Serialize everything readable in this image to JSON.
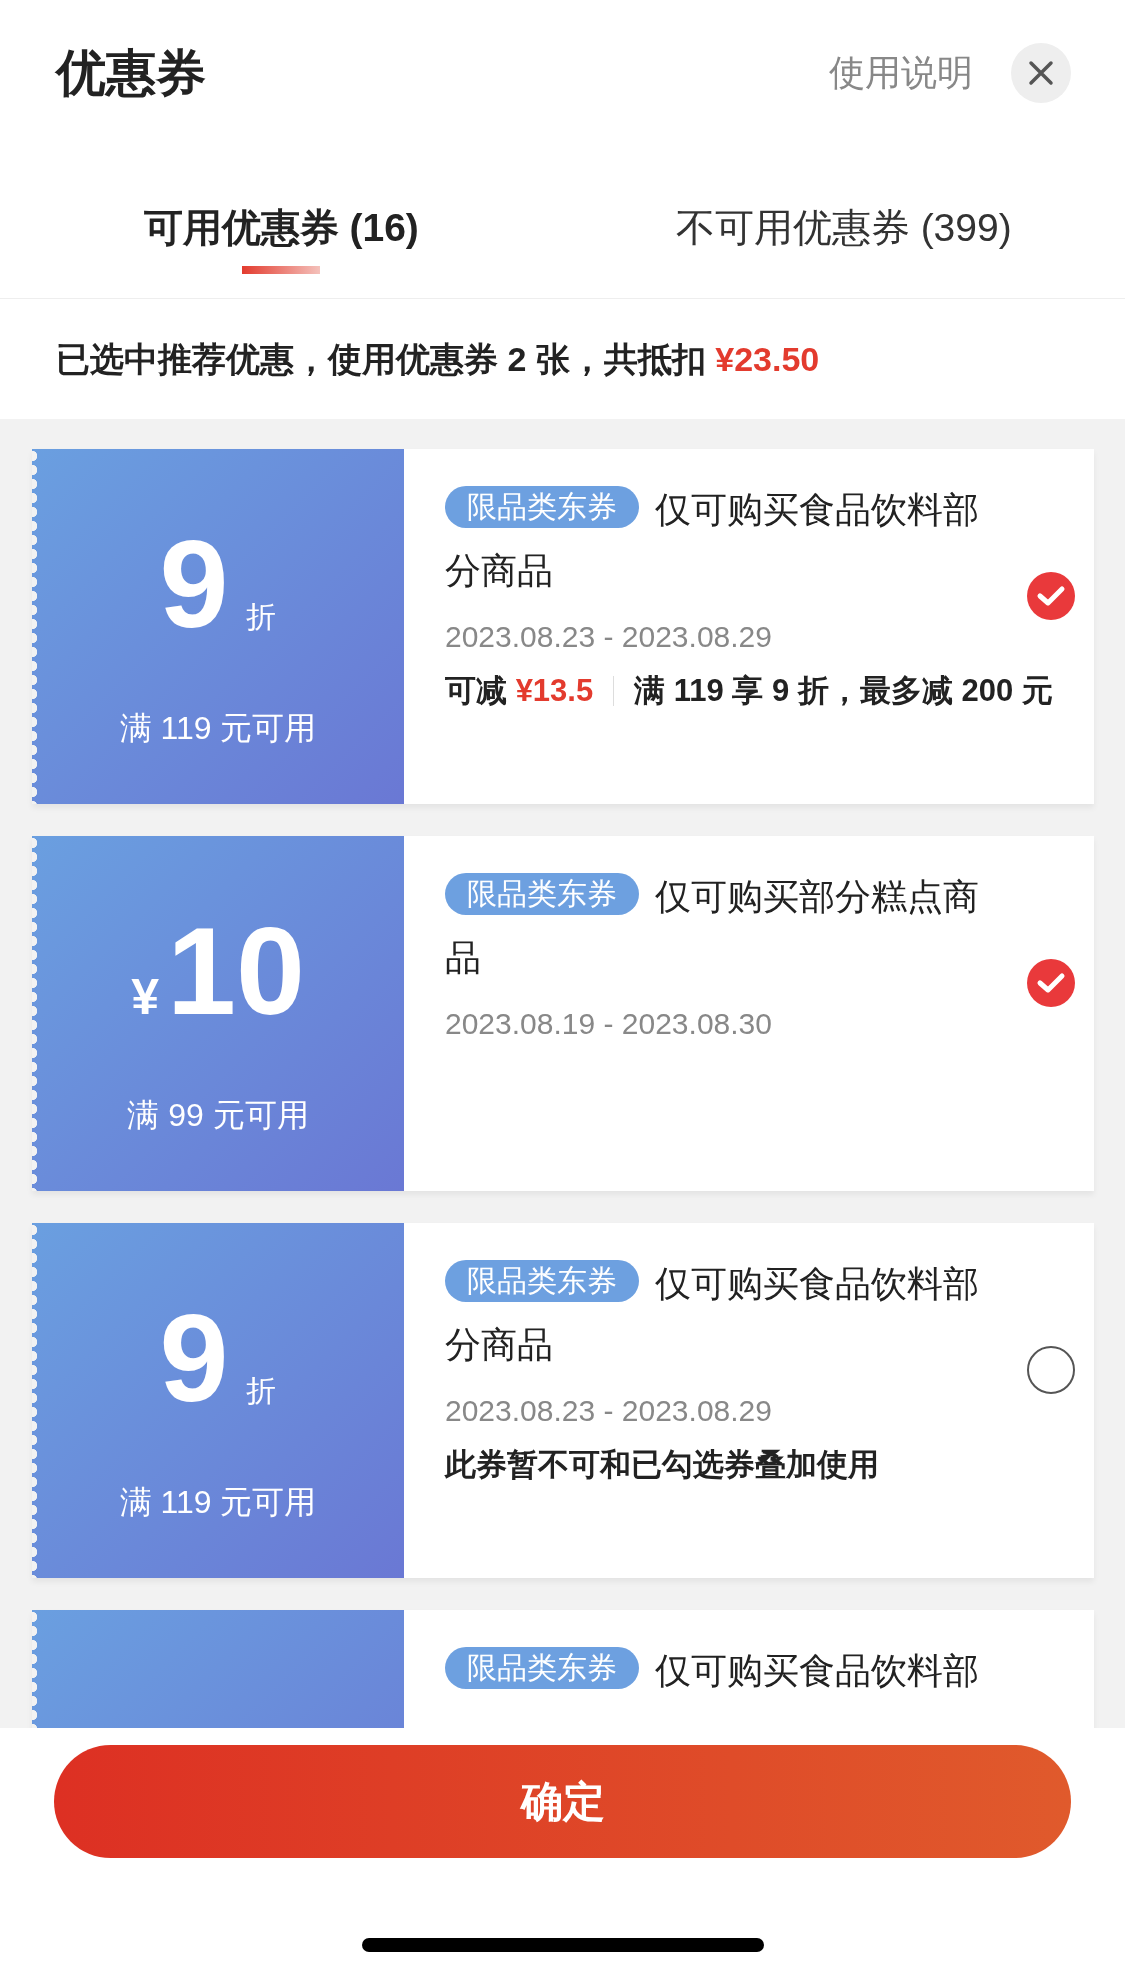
{
  "header": {
    "title": "优惠券",
    "help_link": "使用说明"
  },
  "tabs": [
    {
      "label": "可用优惠券 (16)",
      "selected": true
    },
    {
      "label": "不可用优惠券 (399)",
      "selected": false
    }
  ],
  "summary": {
    "text": "已选中推荐优惠，使用优惠券 2 张，共抵扣",
    "amount": "¥23.50"
  },
  "coupons": [
    {
      "value": {
        "kind": "discount",
        "amount": "9",
        "unit": "折"
      },
      "condition": "满 119 元可用",
      "tag": "限品类东券",
      "description_lines": [
        "仅可购买食品饮料部",
        "分商品"
      ],
      "validity": "2023.08.23 - 2023.08.29",
      "savings": {
        "label": "可减",
        "amount": "¥13.5"
      },
      "rule": "满 119 享 9 折，最多减 200 元",
      "selected": true
    },
    {
      "value": {
        "kind": "cash",
        "currency": "¥",
        "amount": "10"
      },
      "condition": "满 99 元可用",
      "tag": "限品类东券",
      "description_lines": [
        "仅可购买部分糕点商",
        "品"
      ],
      "validity": "2023.08.19 - 2023.08.30",
      "selected": true
    },
    {
      "value": {
        "kind": "discount",
        "amount": "9",
        "unit": "折"
      },
      "condition": "满 119 元可用",
      "tag": "限品类东券",
      "description_lines": [
        "仅可购买食品饮料部",
        "分商品"
      ],
      "validity": "2023.08.23 - 2023.08.29",
      "note": "此券暂不可和已勾选券叠加使用",
      "selected": false
    },
    {
      "tag": "限品类东券",
      "description_lines": [
        "仅可购买食品饮料部"
      ]
    }
  ],
  "confirm_button": "确定"
}
